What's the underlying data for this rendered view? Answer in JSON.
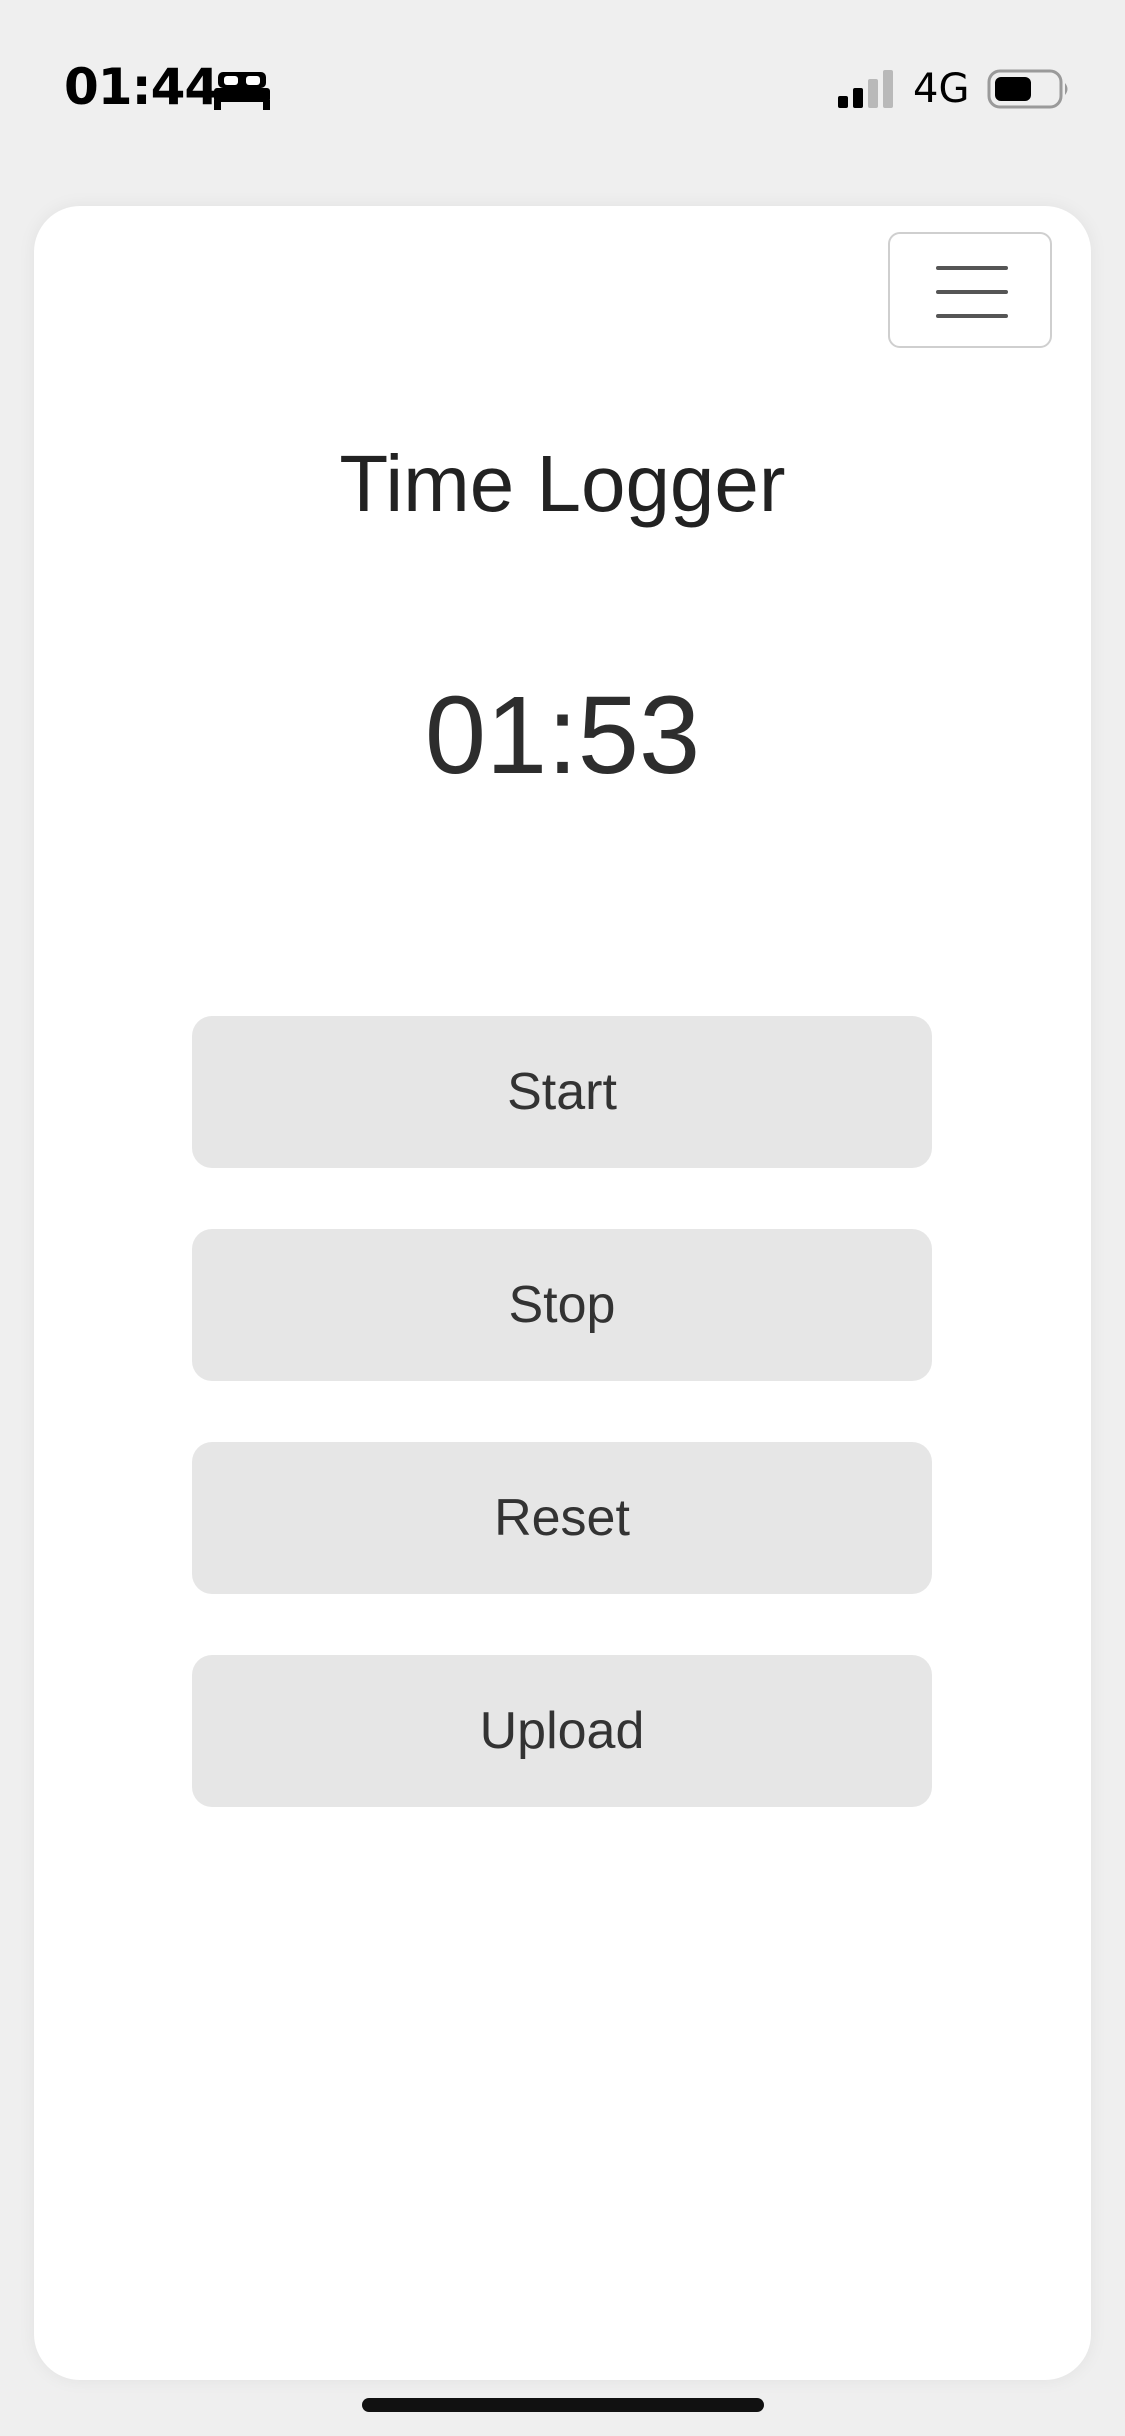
{
  "status_bar": {
    "time": "01:44",
    "focus_icon": "bed-icon",
    "signal_icon": "cellular-signal-icon",
    "network": "4G",
    "battery_icon": "battery-icon"
  },
  "app": {
    "title": "Time Logger",
    "timer": "01:53",
    "menu_icon": "hamburger-menu-icon"
  },
  "buttons": {
    "start": "Start",
    "stop": "Stop",
    "reset": "Reset",
    "upload": "Upload"
  },
  "colors": {
    "background": "#efefef",
    "card": "#ffffff",
    "button": "#e6e6e6",
    "text": "#2a2a2a"
  }
}
